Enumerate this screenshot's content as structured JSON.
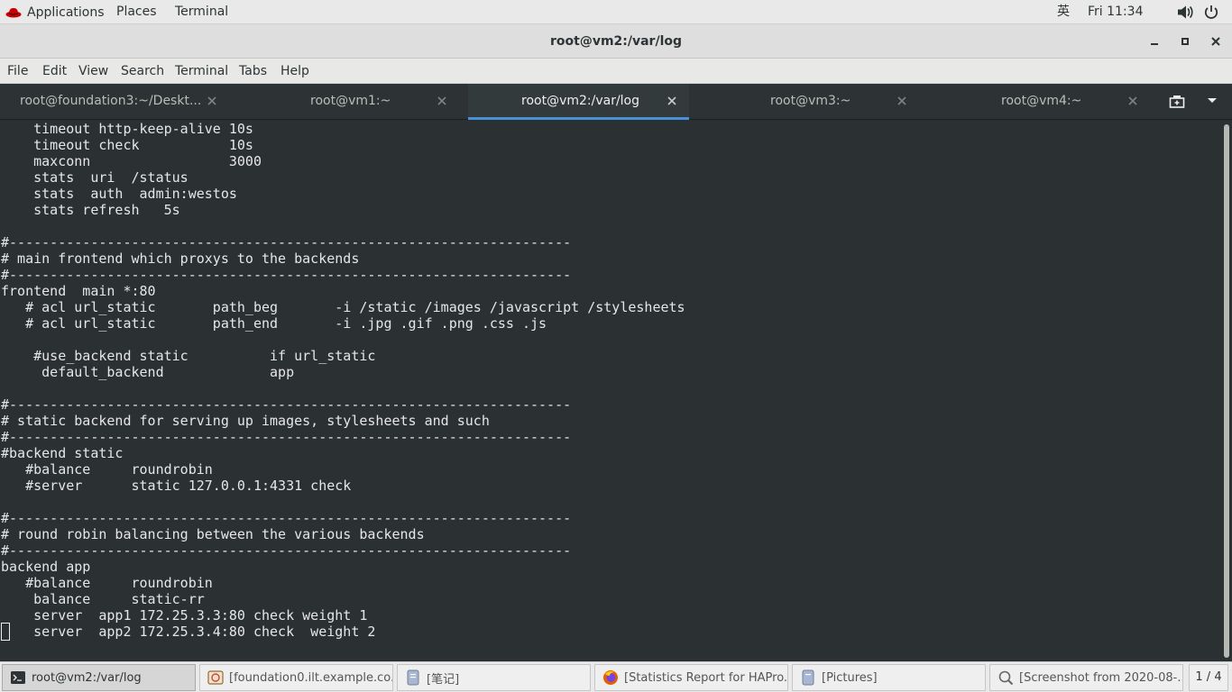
{
  "top_panel": {
    "applications": "Applications",
    "places": "Places",
    "terminal": "Terminal",
    "input_method": "英",
    "clock": "Fri 11:34",
    "icons": [
      "redhat-icon",
      "volume-icon",
      "power-icon"
    ]
  },
  "window": {
    "title": "root@vm2:/var/log"
  },
  "menubar": {
    "items": [
      "File",
      "Edit",
      "View",
      "Search",
      "Terminal",
      "Tabs",
      "Help"
    ]
  },
  "tabs": [
    {
      "label": "root@foundation3:~/Deskt..."
    },
    {
      "label": "root@vm1:~"
    },
    {
      "label": "root@vm2:/var/log",
      "active": true
    },
    {
      "label": "root@vm3:~"
    },
    {
      "label": "root@vm4:~"
    }
  ],
  "terminal": {
    "lines": [
      "    timeout http-keep-alive 10s",
      "    timeout check           10s",
      "    maxconn                 3000",
      "    stats  uri  /status",
      "    stats  auth  admin:westos",
      "    stats refresh   5s",
      "",
      "#---------------------------------------------------------------------",
      "# main frontend which proxys to the backends",
      "#---------------------------------------------------------------------",
      "frontend  main *:80",
      "   # acl url_static       path_beg       -i /static /images /javascript /stylesheets",
      "   # acl url_static       path_end       -i .jpg .gif .png .css .js",
      "",
      "    #use_backend static          if url_static",
      "     default_backend             app",
      "",
      "#---------------------------------------------------------------------",
      "# static backend for serving up images, stylesheets and such",
      "#---------------------------------------------------------------------",
      "#backend static",
      "   #balance     roundrobin",
      "   #server      static 127.0.0.1:4331 check",
      "",
      "#---------------------------------------------------------------------",
      "# round robin balancing between the various backends",
      "#---------------------------------------------------------------------",
      "backend app",
      "   #balance     roundrobin",
      "    balance     static-rr",
      "    server  app1 172.25.3.3:80 check weight 1",
      "    server  app2 172.25.3.4:80 check  weight 2"
    ]
  },
  "taskbar": {
    "items": [
      {
        "label": "root@vm2:/var/log",
        "icon": "terminal-icon",
        "active": true
      },
      {
        "label": "[foundation0.ilt.example.co...",
        "icon": "virt-manager-icon"
      },
      {
        "label": "[笔记]",
        "icon": "document-icon"
      },
      {
        "label": "[Statistics Report for HAPro...",
        "icon": "firefox-icon"
      },
      {
        "label": "[Pictures]",
        "icon": "folder-icon"
      },
      {
        "label": "[Screenshot from 2020-08-...",
        "icon": "screenshot-icon"
      }
    ],
    "workspace": "1 / 4"
  }
}
